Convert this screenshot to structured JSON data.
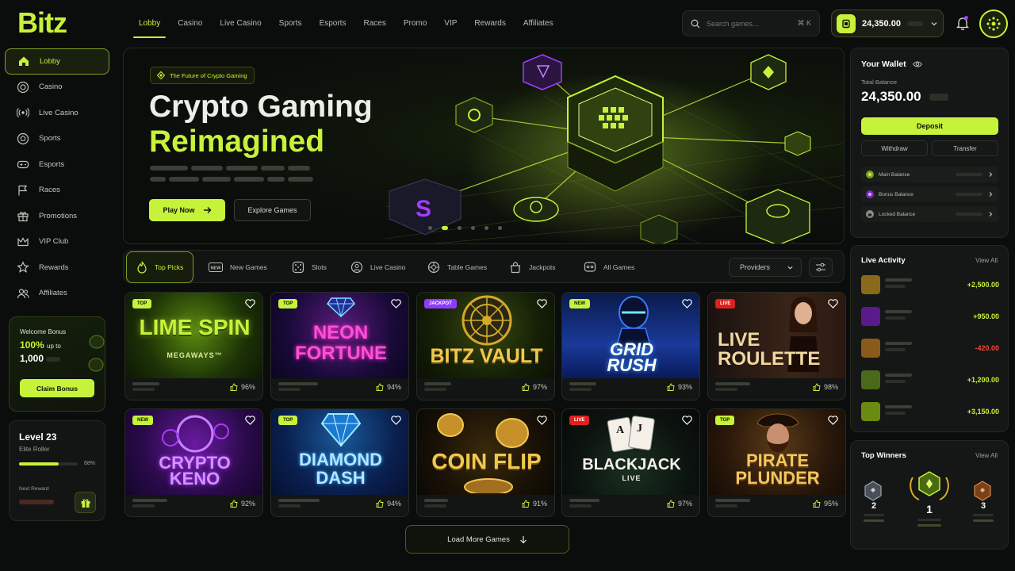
{
  "app": {
    "logo": "Bitz"
  },
  "topnav": {
    "items": [
      "Lobby",
      "Casino",
      "Live Casino",
      "Sports",
      "Esports",
      "Races",
      "Promo",
      "VIP",
      "Rewards",
      "Affiliates"
    ],
    "active": "Lobby"
  },
  "search": {
    "placeholder": "Search games...",
    "shortcut": "⌘ K"
  },
  "header_balance": {
    "amount": "24,350.00"
  },
  "sidebar": {
    "items": [
      {
        "label": "Lobby",
        "icon": "home-icon"
      },
      {
        "label": "Casino",
        "icon": "chip-icon"
      },
      {
        "label": "Live Casino",
        "icon": "broadcast-icon"
      },
      {
        "label": "Sports",
        "icon": "ball-icon"
      },
      {
        "label": "Esports",
        "icon": "gamepad-icon"
      },
      {
        "label": "Races",
        "icon": "flag-icon"
      },
      {
        "label": "Promotions",
        "icon": "gift-icon"
      },
      {
        "label": "VIP Club",
        "icon": "crown-icon"
      },
      {
        "label": "Rewards",
        "icon": "star-icon"
      },
      {
        "label": "Affiliates",
        "icon": "users-icon"
      }
    ]
  },
  "bonus": {
    "title": "Welcome Bonus",
    "percent": "100%",
    "upto": "up to",
    "amount": "1,000",
    "cta": "Claim Bonus"
  },
  "level": {
    "title": "Level 23",
    "tier": "Elite Roller",
    "progress_pct": "68%",
    "progress": 0.68,
    "next_reward": "Next Reward"
  },
  "hero": {
    "tag": "The Future of Crypto Gaming",
    "line1": "Crypto Gaming",
    "line2": "Reimagined",
    "play": "Play Now",
    "explore": "Explore Games",
    "slides": 6,
    "active_slide": 1
  },
  "categories": {
    "items": [
      {
        "label": "Top Picks",
        "icon": "flame-icon"
      },
      {
        "label": "New Games",
        "icon": "new-icon"
      },
      {
        "label": "Slots",
        "icon": "dice-icon"
      },
      {
        "label": "Live Casino",
        "icon": "live-icon"
      },
      {
        "label": "Table Games",
        "icon": "roulette-icon"
      },
      {
        "label": "Jackpots",
        "icon": "bag-icon"
      },
      {
        "label": "All Games",
        "icon": "grid-icon"
      }
    ],
    "providers": "Providers"
  },
  "games": [
    {
      "title": "LIME SPIN",
      "sub": "MEGAWAYS™",
      "badge": "TOP",
      "rating": "96%"
    },
    {
      "title": "NEON FORTUNE",
      "sub": "",
      "badge": "TOP",
      "rating": "94%"
    },
    {
      "title": "BITZ VAULT",
      "sub": "",
      "badge": "JACKPOT",
      "rating": "97%"
    },
    {
      "title": "GRID RUSH",
      "sub": "",
      "badge": "NEW",
      "rating": "93%"
    },
    {
      "title": "LIVE ROULETTE",
      "sub": "",
      "badge": "LIVE",
      "rating": "98%"
    },
    {
      "title": "CRYPTO KENO",
      "sub": "",
      "badge": "NEW",
      "rating": "92%"
    },
    {
      "title": "DIAMOND DASH",
      "sub": "",
      "badge": "TOP",
      "rating": "94%"
    },
    {
      "title": "COIN FLIP",
      "sub": "",
      "badge": "",
      "rating": "91%"
    },
    {
      "title": "BLACKJACK",
      "sub": "LIVE",
      "badge": "LIVE",
      "rating": "97%"
    },
    {
      "title": "PIRATE PLUNDER",
      "sub": "",
      "badge": "TOP",
      "rating": "95%"
    }
  ],
  "load_more": "Load More Games",
  "wallet": {
    "title": "Your Wallet",
    "total_label": "Total Balance",
    "total": "24,350.00",
    "deposit": "Deposit",
    "withdraw": "Withdraw",
    "transfer": "Transfer",
    "balances": [
      "Main Balance",
      "Bonus Balance",
      "Locked Balance"
    ]
  },
  "activity": {
    "title": "Live Activity",
    "view_all": "View All",
    "rows": [
      {
        "amount": "+2,500.00",
        "positive": true
      },
      {
        "amount": "+950.00",
        "positive": true
      },
      {
        "amount": "-420.00",
        "positive": false
      },
      {
        "amount": "+1,200.00",
        "positive": true
      },
      {
        "amount": "+3,150.00",
        "positive": true
      }
    ]
  },
  "winners": {
    "title": "Top Winners",
    "view_all": "View All",
    "ranks": [
      "2",
      "1",
      "3"
    ]
  },
  "colors": {
    "accent": "#c7f23a",
    "negative": "#f04a3a",
    "background": "#0b0d0c"
  }
}
